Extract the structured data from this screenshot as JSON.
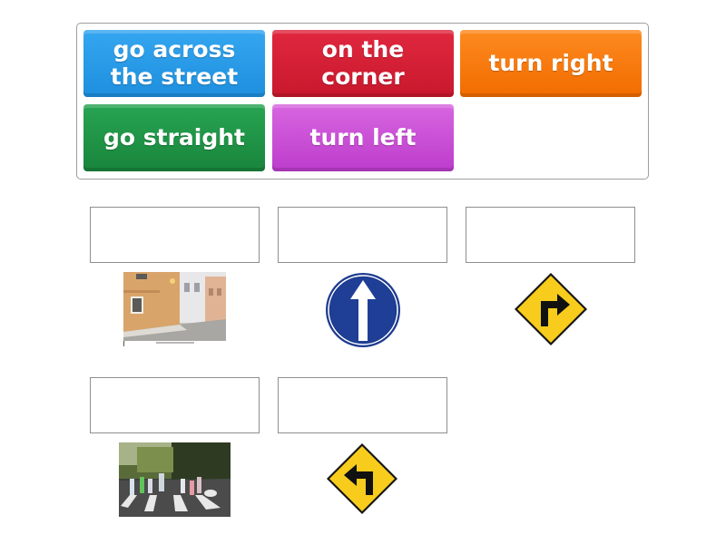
{
  "activity": {
    "tiles": [
      {
        "label_lines": [
          "go across",
          "the street"
        ],
        "color": "#2a9be8"
      },
      {
        "label_lines": [
          "on the corner"
        ],
        "color": "#d81f35"
      },
      {
        "label_lines": [
          "turn right"
        ],
        "color": "#fa7a0c"
      },
      {
        "label_lines": [
          "go straight"
        ],
        "color": "#1f9546"
      },
      {
        "label_lines": [
          "turn left"
        ],
        "color": "#c94fd6"
      }
    ],
    "targets": [
      {
        "answer": "",
        "image": "street-corner-photo"
      },
      {
        "answer": "",
        "image": "straight-arrow-sign"
      },
      {
        "answer": "",
        "image": "turn-right-sign"
      },
      {
        "answer": "",
        "image": "crosswalk-photo"
      },
      {
        "answer": "",
        "image": "turn-left-sign"
      }
    ]
  }
}
